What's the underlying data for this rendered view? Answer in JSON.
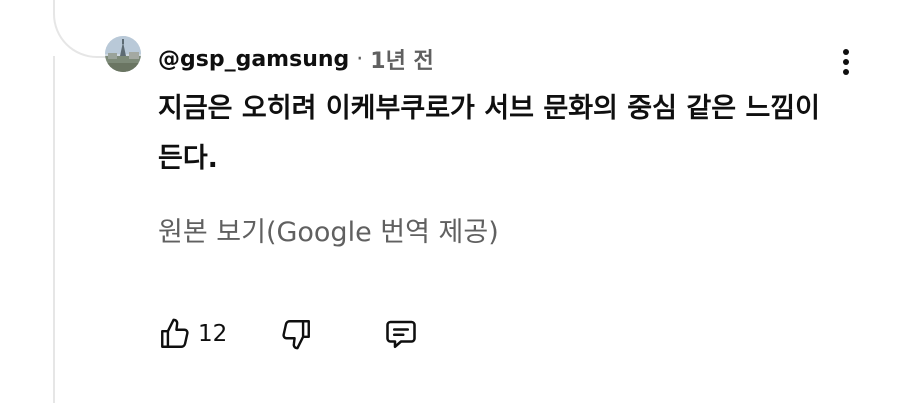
{
  "comment": {
    "author_handle": "@gsp_gamsung",
    "separator": "·",
    "time_ago": "1년 전",
    "text": "지금은 오히려 이케부쿠로가 서브 문화의 중심 같은 느낌이 든다.",
    "translation_link": "원본 보기(Google 번역 제공)",
    "like_count": "12"
  },
  "icons": {
    "avatar": "avatar-photo",
    "menu": "more-vertical-icon",
    "like": "thumbs-up-icon",
    "dislike": "thumbs-down-icon",
    "reply": "reply-comment-icon"
  },
  "colors": {
    "text_primary": "#0f0f0f",
    "text_secondary": "#606060",
    "thread_line": "#e6e6e6"
  }
}
